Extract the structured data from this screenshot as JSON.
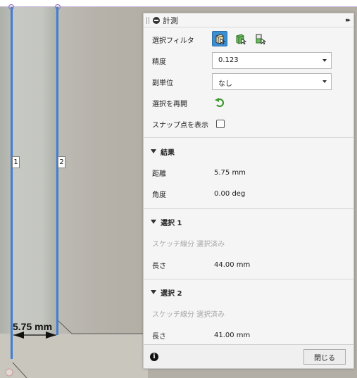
{
  "viewport": {
    "edge_tags": [
      "1",
      "2"
    ],
    "dimension_label": "5.75 mm"
  },
  "panel": {
    "title": "計測",
    "expand_symbol": "▸▸",
    "selection_filter_label": "選択フィルタ",
    "filter_icons": [
      "face-filter-icon",
      "body-filter-icon",
      "component-filter-icon"
    ],
    "precision_label": "精度",
    "precision_value": "0.123",
    "secondary_unit_label": "副単位",
    "secondary_unit_value": "なし",
    "restart_selection_label": "選択を再開",
    "show_snap_points_label": "スナップ点を表示",
    "show_snap_points_checked": false,
    "results": {
      "title": "結果",
      "distance_label": "距離",
      "distance_value": "5.75 mm",
      "angle_label": "角度",
      "angle_value": "0.00 deg"
    },
    "selection1": {
      "title": "選択 1",
      "status": "スケッチ線分 選択済み",
      "length_label": "長さ",
      "length_value": "44.00 mm"
    },
    "selection2": {
      "title": "選択 2",
      "status": "スケッチ線分 選択済み",
      "length_label": "長さ",
      "length_value": "41.00 mm"
    },
    "close_label": "閉じる"
  },
  "colors": {
    "accent": "#3a8fd2",
    "edge_highlight": "#3e7ed3",
    "restart_icon": "#3d9a2f"
  }
}
